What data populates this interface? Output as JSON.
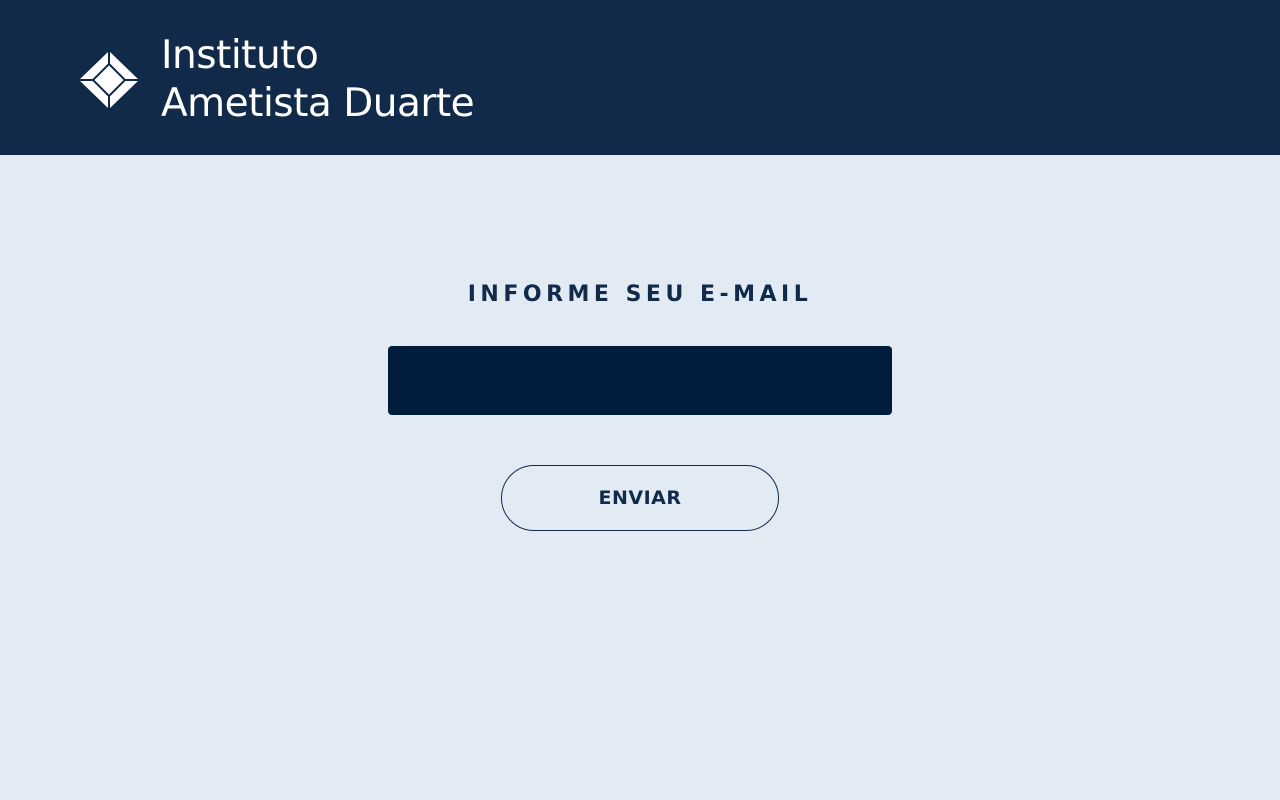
{
  "header": {
    "logo_icon": "diamond-logo-icon",
    "brand_line1": "Instituto",
    "brand_line2": "Ametista Duarte",
    "background_color": "#112a4a"
  },
  "form": {
    "title": "INFORME SEU E-MAIL",
    "email_value": "",
    "submit_label": "ENVIAR"
  },
  "colors": {
    "page_background": "#e2ebf4",
    "input_background": "#001d3d",
    "accent": "#112a4a"
  }
}
